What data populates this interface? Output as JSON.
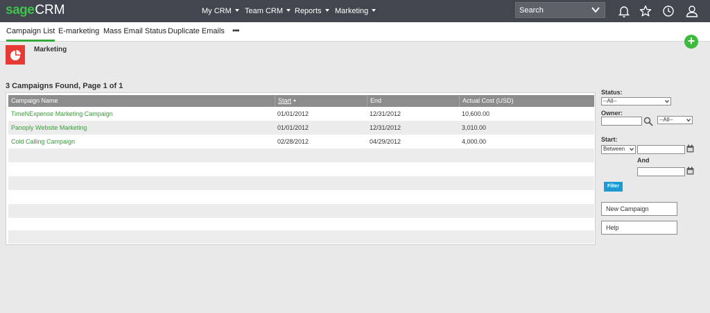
{
  "app": {
    "logo_sage": "sage",
    "logo_crm": "CRM",
    "brand_color": "#41c24a"
  },
  "topnav": {
    "items": [
      {
        "label": "My CRM"
      },
      {
        "label": "Team CRM"
      },
      {
        "label": "Reports"
      },
      {
        "label": "Marketing"
      }
    ],
    "search_placeholder": "Search",
    "icons": [
      "bell-icon",
      "star-icon",
      "clock-icon",
      "user-icon"
    ]
  },
  "tabs": {
    "items": [
      {
        "label": "Campaign List",
        "active": true
      },
      {
        "label": "E-marketing"
      },
      {
        "label": "Mass Email Status"
      },
      {
        "label": "Duplicate Emails"
      }
    ],
    "more": "•••",
    "add": "+"
  },
  "page": {
    "title": "Marketing",
    "icon": "pie-chart-icon",
    "found_text": "3 Campaigns Found, Page 1 of 1"
  },
  "table": {
    "columns": [
      "Campaign Name",
      "Start",
      "End",
      "Actual Cost (USD)"
    ],
    "rows": [
      {
        "name": "TimeNExpense Marketing Campaign",
        "start": "01/01/2012",
        "end": "12/31/2012",
        "cost": "10,600.00"
      },
      {
        "name": "Panoply Website Marketing",
        "start": "01/01/2012",
        "end": "12/31/2012",
        "cost": "3,010.00"
      },
      {
        "name": "Cold Calling Campaign",
        "start": "02/28/2012",
        "end": "04/29/2012",
        "cost": "4,000.00"
      }
    ]
  },
  "filters": {
    "status_label": "Status:",
    "status_value": "--All--",
    "owner_label": "Owner:",
    "owner_value": "--All--",
    "start_label": "Start:",
    "start_mode": "Between",
    "and_label": "And",
    "filter_button": "Filter"
  },
  "actions": {
    "new_campaign": "New Campaign",
    "help": "Help"
  }
}
